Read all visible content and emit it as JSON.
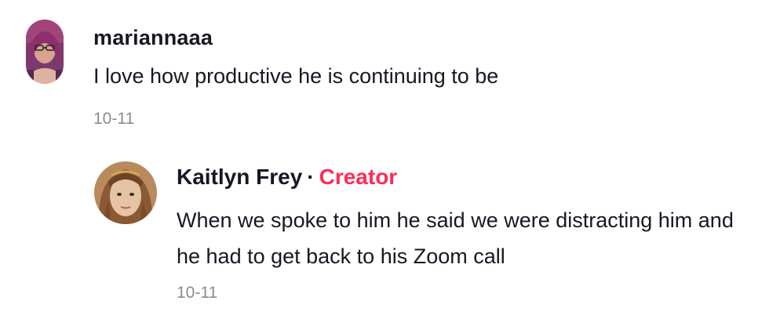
{
  "comments": [
    {
      "username": "mariannaaa",
      "text": "I love how productive he is continuing to be",
      "date": "10-11",
      "avatar": "user-avatar"
    }
  ],
  "reply": {
    "username": "Kaitlyn Frey",
    "separator": "·",
    "badge": "Creator",
    "text": "When we spoke to him he said we were distracting him and he had to get back to his Zoom call",
    "date": "10-11",
    "avatar": "creator-avatar"
  },
  "colors": {
    "text_primary": "#161823",
    "text_secondary": "#8a8b91",
    "creator_badge": "#fe2c55"
  }
}
